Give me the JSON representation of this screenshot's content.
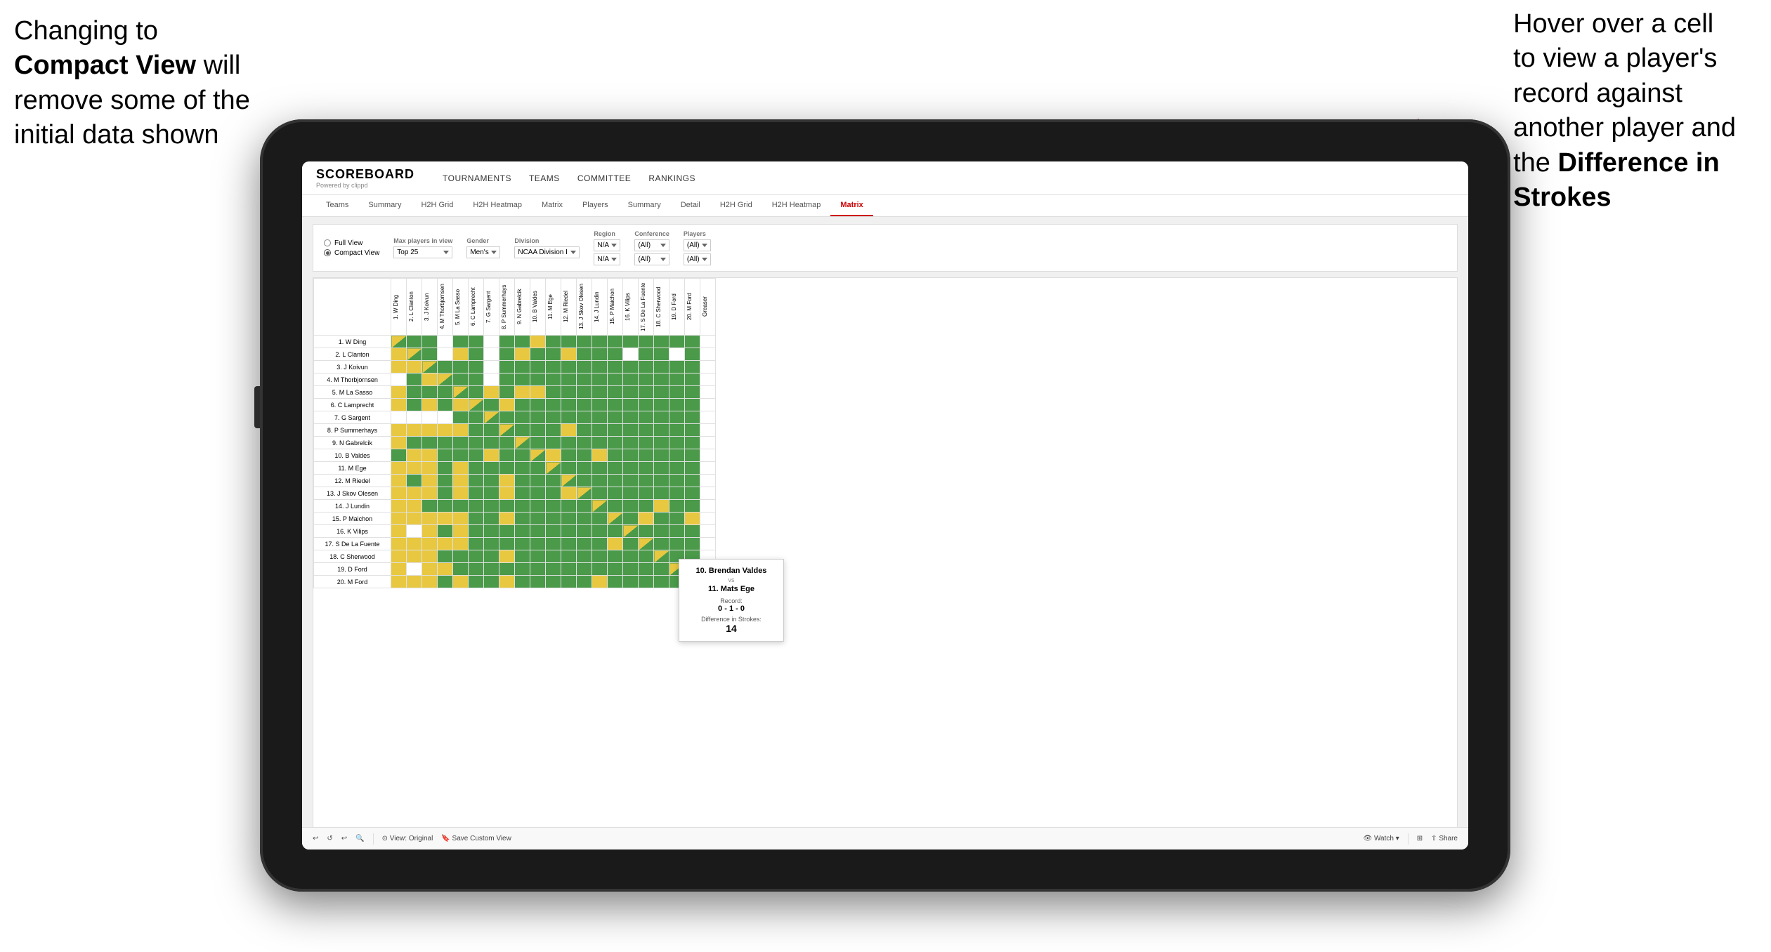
{
  "annotation_left": {
    "line1": "Changing to",
    "line2_bold": "Compact View",
    "line2_rest": " will",
    "line3": "remove some of the",
    "line4": "initial data shown"
  },
  "annotation_right": {
    "line1": "Hover over a cell",
    "line2": "to view a player's",
    "line3": "record against",
    "line4": "another player and",
    "line5_pre": "the ",
    "line5_bold": "Difference in",
    "line6_bold": "Strokes"
  },
  "app": {
    "logo": "SCOREBOARD",
    "logo_sub": "Powered by clippd",
    "nav": [
      "TOURNAMENTS",
      "TEAMS",
      "COMMITTEE",
      "RANKINGS"
    ],
    "tabs_top": [
      "Teams",
      "Summary",
      "H2H Grid",
      "H2H Heatmap",
      "Matrix",
      "Players",
      "Summary",
      "Detail",
      "H2H Grid",
      "H2H Heatmap",
      "Matrix"
    ],
    "active_tab": "Matrix",
    "filters": {
      "view_options": [
        "Full View",
        "Compact View"
      ],
      "selected_view": "Compact View",
      "max_players_label": "Max players in view",
      "max_players_value": "Top 25",
      "gender_label": "Gender",
      "gender_value": "Men's",
      "division_label": "Division",
      "division_value": "NCAA Division I",
      "region_label": "Region",
      "region_value": "N/A",
      "conference_label": "Conference",
      "conference_value": "(All)",
      "players_label": "Players",
      "players_value": "(All)"
    },
    "col_headers": [
      "1. W Ding",
      "2. L Clanton",
      "3. J Koivun",
      "4. M Thorbjornsen",
      "5. M La Sasso",
      "6. C Lamprecht",
      "7. G Sargent",
      "8. P Summerhays",
      "9. N Gabrelcik",
      "10. B Valdes",
      "11. M Ege",
      "12. M Riedel",
      "13. J Skov Olesen",
      "14. J Lundin",
      "15. P Maichon",
      "16. K Vilips",
      "17. S De La Fuente",
      "18. C Sherwood",
      "19. D Ford",
      "20. M Ford",
      "Greaser"
    ],
    "row_headers": [
      "1. W Ding",
      "2. L Clanton",
      "3. J Koivun",
      "4. M Thorbjornsen",
      "5. M La Sasso",
      "6. C Lamprecht",
      "7. G Sargent",
      "8. P Summerhays",
      "9. N Gabrelcik",
      "10. B Valdes",
      "11. M Ege",
      "12. M Riedel",
      "13. J Skov Olesen",
      "14. J Lundin",
      "15. P Maichon",
      "16. K Vilips",
      "17. S De La Fuente",
      "18. C Sherwood",
      "19. D Ford",
      "20. M Ford"
    ],
    "tooltip": {
      "player1": "10. Brendan Valdes",
      "vs": "vs",
      "player2": "11. Mats Ege",
      "record_label": "Record:",
      "record": "0 - 1 - 0",
      "diff_label": "Difference in Strokes:",
      "diff": "14"
    },
    "toolbar": {
      "undo": "↩",
      "redo": "↪",
      "zoom_in": "+",
      "zoom_out": "−",
      "view_original": "⊙ View: Original",
      "save_custom": "🔖 Save Custom View",
      "watch": "👁 Watch ▾",
      "share": "⇧ Share"
    }
  }
}
